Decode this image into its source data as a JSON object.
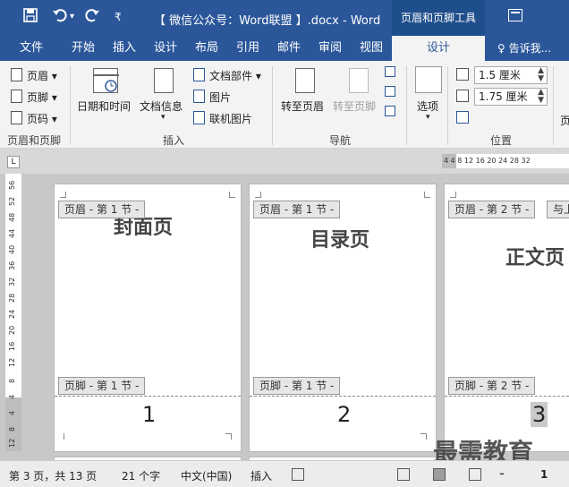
{
  "titlebar": {
    "title": "【 微信公众号：Word联盟 】.docx - Word",
    "context_group": "页眉和页脚工具",
    "quick_access_icons": [
      "save-icon",
      "undo-icon",
      "redo-icon",
      "customize-icon"
    ]
  },
  "tabs": {
    "file": "文件",
    "home": "开始",
    "insert": "插入",
    "design": "设计",
    "layout": "布局",
    "references": "引用",
    "mailings": "邮件",
    "review": "审阅",
    "view": "视图",
    "hf_design": "设计",
    "tell_me": "♀ 告诉我..."
  },
  "ribbon": {
    "header_btn": "页眉 ▾",
    "footer_btn": "页脚 ▾",
    "page_number_btn": "页码 ▾",
    "group_header_footer": "页眉和页脚",
    "date_time": "日期和时间",
    "doc_info": "文档信息",
    "doc_info_arrow": "▾",
    "quick_parts": "文档部件 ▾",
    "pictures": "图片",
    "online_pictures": "联机图片",
    "group_insert": "插入",
    "goto_header": "转至页眉",
    "goto_footer": "转至页脚",
    "group_navigation": "导航",
    "options": "选项",
    "options_arrow": "▾",
    "header_top_value": "1.5 厘米",
    "footer_bottom_value": "1.75 厘米",
    "group_position": "位置",
    "close_partial": "页"
  },
  "ruler": {
    "horizontal_ticks": "4   4   8  12  16  20  24  28  32",
    "corner": "L",
    "vertical_ticks": [
      "56",
      "52",
      "48",
      "44",
      "40",
      "36",
      "32",
      "28",
      "24",
      "20",
      "16",
      "12",
      "8",
      "4",
      "4",
      "8",
      "12"
    ]
  },
  "pages": [
    {
      "title": "封面页",
      "header_tag": "页眉 - 第 1 节 -",
      "footer_tag": "页脚 - 第 1 节 -",
      "number": "1"
    },
    {
      "title": "目录页",
      "header_tag": "页眉 - 第 1 节 -",
      "footer_tag": "页脚 - 第 1 节 -",
      "number": "2"
    },
    {
      "title": "正文页",
      "header_tag": "页眉 - 第 2 节 -",
      "header_tag_extra": "与上",
      "footer_tag": "页脚 - 第 2 节 -",
      "number": "3"
    }
  ],
  "watermark": "最需教育",
  "status": {
    "page": "第 3 页，共 13 页",
    "words": "21 个字",
    "language": "中文(中国)",
    "mode": "插入",
    "zoom_minus": "-",
    "zoom_partial": "1"
  },
  "colors": {
    "accent": "#2b579a",
    "context_tab": "#1f4e8c",
    "ribbon_bg": "#f3f3f3"
  }
}
